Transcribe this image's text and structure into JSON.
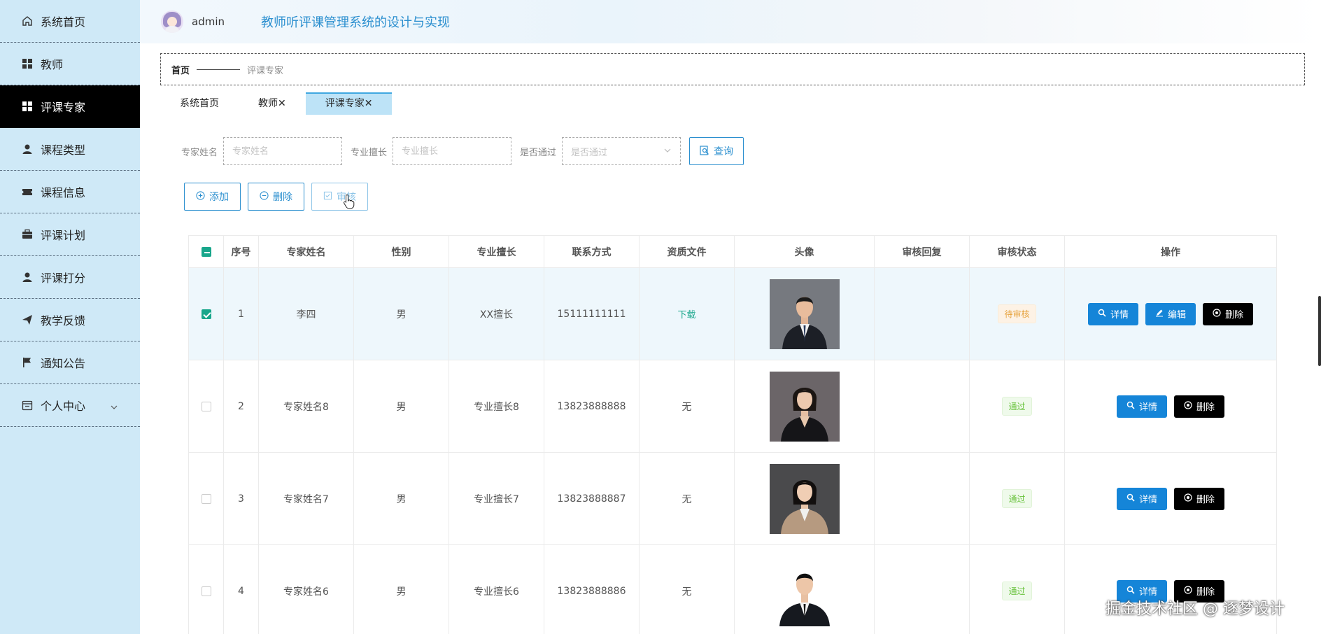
{
  "sidebar": {
    "items": [
      {
        "label": "系统首页",
        "icon": "home-icon"
      },
      {
        "label": "教师",
        "icon": "grid-icon"
      },
      {
        "label": "评课专家",
        "icon": "grid-icon"
      },
      {
        "label": "课程类型",
        "icon": "user-icon"
      },
      {
        "label": "课程信息",
        "icon": "ticket-icon"
      },
      {
        "label": "评课计划",
        "icon": "briefcase-icon"
      },
      {
        "label": "评课打分",
        "icon": "user-icon"
      },
      {
        "label": "教学反馈",
        "icon": "send-icon"
      },
      {
        "label": "通知公告",
        "icon": "flag-icon"
      },
      {
        "label": "个人中心",
        "icon": "calendar-icon"
      }
    ],
    "active_index": 2
  },
  "header": {
    "username": "admin",
    "title": "教师听评课管理系统的设计与实现"
  },
  "breadcrumb": {
    "home": "首页",
    "current": "评课专家"
  },
  "tabs": [
    {
      "label": "系统首页"
    },
    {
      "label": "教师✕"
    },
    {
      "label": "评课专家✕"
    }
  ],
  "search": {
    "name_label": "专家姓名",
    "name_placeholder": "专家姓名",
    "specialty_label": "专业擅长",
    "specialty_placeholder": "专业擅长",
    "passed_label": "是否通过",
    "passed_placeholder": "是否通过",
    "query_button": "查询"
  },
  "actions": {
    "add": "添加",
    "delete": "删除",
    "review": "审核"
  },
  "table": {
    "headers": [
      "序号",
      "专家姓名",
      "性别",
      "专业擅长",
      "联系方式",
      "资质文件",
      "头像",
      "审核回复",
      "审核状态",
      "操作"
    ],
    "rows": [
      {
        "index": "1",
        "name": "李四",
        "gender": "男",
        "specialty": "XX擅长",
        "phone": "15111111111",
        "file": "下载",
        "reply": "",
        "status": "待审核"
      },
      {
        "index": "2",
        "name": "专家姓名8",
        "gender": "男",
        "specialty": "专业擅长8",
        "phone": "13823888888",
        "file": "无",
        "reply": "",
        "status": "通过"
      },
      {
        "index": "3",
        "name": "专家姓名7",
        "gender": "男",
        "specialty": "专业擅长7",
        "phone": "13823888887",
        "file": "无",
        "reply": "",
        "status": "通过"
      },
      {
        "index": "4",
        "name": "专家姓名6",
        "gender": "男",
        "specialty": "专业擅长6",
        "phone": "13823888886",
        "file": "无",
        "reply": "",
        "status": "通过"
      }
    ],
    "op_detail": "详情",
    "op_edit": "编辑",
    "op_delete": "删除"
  },
  "watermark": "掘金技术社区 @ 逐梦设计",
  "colors": {
    "sidebar_bg": "#cfe9f7",
    "accent": "#2b8fcf",
    "button_blue": "#1585d8",
    "check_green": "#18a68b"
  }
}
